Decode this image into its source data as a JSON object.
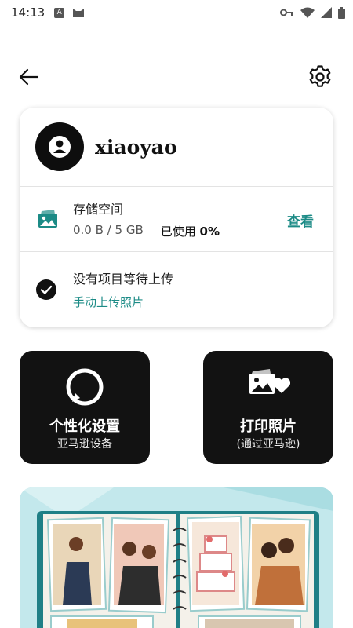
{
  "status_bar": {
    "time": "14:13",
    "left_icons": [
      "font-app-icon",
      "cat-app-icon"
    ],
    "right_icons": [
      "key-icon",
      "wifi-icon",
      "signal-icon",
      "battery-icon"
    ]
  },
  "top_bar": {
    "back_icon": "back-arrow-icon",
    "settings_icon": "gear-icon"
  },
  "account": {
    "username": "xiaoyao",
    "avatar_icon": "person-icon"
  },
  "storage": {
    "title": "存储空间",
    "usage": "0.0 B / 5 GB",
    "used_label": "已使用",
    "used_percent": "0%",
    "view_label": "查看",
    "icon": "photo-stack-icon"
  },
  "upload": {
    "status": "没有项目等待上传",
    "manual_link": "手动上传照片",
    "icon": "check-circle-icon"
  },
  "tiles": {
    "personalize": {
      "title": "个性化设置",
      "subtitle": "亚马逊设备",
      "icon": "alexa-ring-icon"
    },
    "print": {
      "title": "打印照片",
      "subtitle": "(通过亚马逊)",
      "icon": "photo-heart-icon"
    }
  },
  "colors": {
    "accent": "#1c8b86",
    "tile_bg": "#121212",
    "banner_bg": "#bfe7ea"
  }
}
